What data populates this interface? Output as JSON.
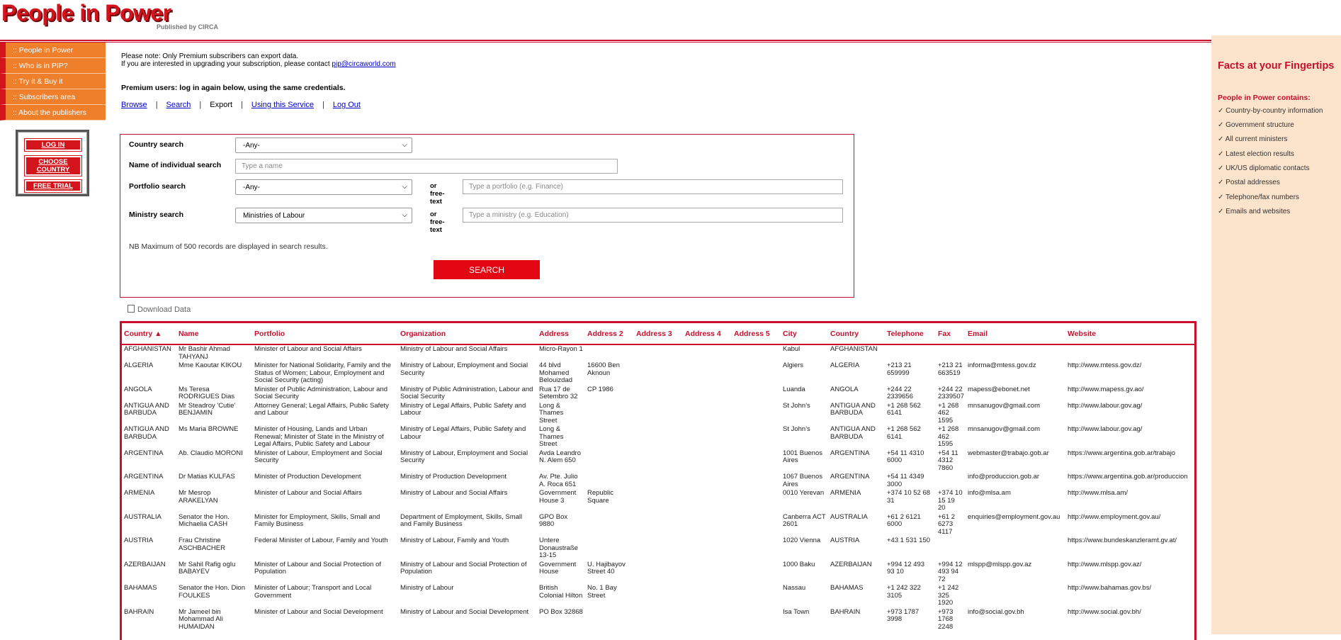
{
  "header": {
    "logo_title": "People in Power",
    "logo_sub": "Published by CIRCA"
  },
  "nav": [
    ":: People in Power",
    ":: Who is in PIP?",
    ":: Try it & Buy it",
    ":: Subscribers area",
    ":: About the publishers"
  ],
  "login_box": {
    "login": "LOG IN",
    "choose_country": "CHOOSE COUNTRY",
    "free_trial": "FREE TRIAL"
  },
  "notes": {
    "line1": "Please note: Only Premium subscribers can export data.",
    "line2": "If you are interested in upgrading your subscription, please contact ",
    "email": "pip@circaworld.com",
    "premium": "Premium users: log in again below, using the same credentials."
  },
  "tabs": {
    "browse": "Browse",
    "search": "Search",
    "export": "Export",
    "using": "Using this Service",
    "logout": "Log Out"
  },
  "form": {
    "country_label": "Country search",
    "country_value": "-Any-",
    "name_label": "Name of individual search",
    "name_placeholder": "Type a name",
    "portfolio_label": "Portfolio search",
    "portfolio_value": "-Any-",
    "portfolio_placeholder": "Type a portfolio (e.g. Finance)",
    "ministry_label": "Ministry search",
    "ministry_value": "Ministries of Labour",
    "ministry_placeholder": "Type a ministry (e.g. Education)",
    "or_text": "or free-text",
    "nb_note": "NB Maximum of 500 records are displayed in search results.",
    "search_button": "SEARCH"
  },
  "download": "Download Data",
  "table": {
    "headers": [
      "Country ▲",
      "Name",
      "Portfolio",
      "Organization",
      "Address",
      "Address 2",
      "Address 3",
      "Address 4",
      "Address 5",
      "City",
      "Country",
      "Telephone",
      "Fax",
      "Email",
      "Website"
    ],
    "rows": [
      [
        "AFGHANISTAN",
        "Mr Bashir Ahmad TAHYANJ",
        "Minister of Labour and Social Affairs",
        "Ministry of Labour and Social Affairs",
        "Micro-Rayon 1",
        "",
        "",
        "",
        "",
        "Kabul",
        "AFGHANISTAN",
        "",
        "",
        "",
        ""
      ],
      [
        "ALGERIA",
        "Mme Kaoutar KIKOU",
        "Minister for National Solidarity, Family and the Status of Women; Labour, Employment and Social Security (acting)",
        "Ministry of Labour, Employment and Social Security",
        "44 blvd Mohamed Belouizdad",
        "16600 Ben Aknoun",
        "",
        "",
        "",
        "Algiers",
        "ALGERIA",
        "+213 21 659999",
        "+213 21 663519",
        "informa@mtess.gov.dz",
        "http://www.mtess.gov.dz/"
      ],
      [
        "ANGOLA",
        "Ms Teresa RODRIGUES Dias",
        "Minister of Public Administration, Labour and Social Security",
        "Ministry of Public Administration, Labour and Social Security",
        "Rua 17 de Setembro 32",
        "CP 1986",
        "",
        "",
        "",
        "Luanda",
        "ANGOLA",
        "+244 22 2339656",
        "+244 22 2339507",
        "mapess@ebonet.net",
        "http://www.mapess.gv.ao/"
      ],
      [
        "ANTIGUA AND BARBUDA",
        "Mr Steadroy 'Cutie' BENJAMIN",
        "Attorney General; Legal Affairs, Public Safety and Labour",
        "Ministry of Legal Affairs, Public Safety and Labour",
        "Long & Thames Street",
        "",
        "",
        "",
        "",
        "St John's",
        "ANTIGUA AND BARBUDA",
        "+1 268 562 6141",
        "+1 268 462 1595",
        "mnsanugov@gmail.com",
        "http://www.labour.gov.ag/"
      ],
      [
        "ANTIGUA AND BARBUDA",
        "Ms Maria BROWNE",
        "Minister of Housing, Lands and Urban Renewal; Minister of State in the Ministry of Legal Affairs, Public Safety and Labour",
        "Ministry of Legal Affairs, Public Safety and Labour",
        "Long & Thames Street",
        "",
        "",
        "",
        "",
        "St John's",
        "ANTIGUA AND BARBUDA",
        "+1 268 562 6141",
        "+1 268 462 1595",
        "mnsanugov@gmail.com",
        "http://www.labour.gov.ag/"
      ],
      [
        "ARGENTINA",
        "Ab. Claudio MORONI",
        "Minister of Labour, Employment and Social Security",
        "Ministry of Labour, Employment and Social Security",
        "Avda Leandro N. Alem 650",
        "",
        "",
        "",
        "",
        "1001 Buenos Aires",
        "ARGENTINA",
        "+54 11 4310 6000",
        "+54 11 4312 7860",
        "webmaster@trabajo.gob.ar",
        "https://www.argentina.gob.ar/trabajo"
      ],
      [
        "ARGENTINA",
        "Dr Matias KULFAS",
        "Minister of Production Development",
        "Ministry of Production Development",
        "Av. Pte. Julio A. Roca 651",
        "",
        "",
        "",
        "",
        "1067 Buenos Aires",
        "ARGENTINA",
        "+54 11 4349 3000",
        "",
        "info@produccion.gob.ar",
        "https://www.argentina.gob.ar/produccion"
      ],
      [
        "ARMENIA",
        "Mr Mesrop ARAKELYAN",
        "Minister of Labour and Social Affairs",
        "Ministry of Labour and Social Affairs",
        "Government House 3",
        "Republic Square",
        "",
        "",
        "",
        "0010 Yerevan",
        "ARMENIA",
        "+374 10 52 68 31",
        "+374 10 15 19 20",
        "info@mlsa.am",
        "http://www.mlsa.am/"
      ],
      [
        "AUSTRALIA",
        "Senator the Hon. Michaelia CASH",
        "Minister for Employment, Skills, Small and Family Business",
        "Department of Employment, Skills, Small and Family Business",
        "GPO Box 9880",
        "",
        "",
        "",
        "",
        "Canberra ACT 2601",
        "AUSTRALIA",
        "+61 2 6121 6000",
        "+61 2 6273 4117",
        "enquiries@employment.gov.au",
        "http://www.employment.gov.au/"
      ],
      [
        "AUSTRIA",
        "Frau Christine ASCHBACHER",
        "Federal Minister of Labour, Family and Youth",
        "Ministry of Labour, Family and Youth",
        "Untere Donaustraße 13-15",
        "",
        "",
        "",
        "",
        "1020 Vienna",
        "AUSTRIA",
        "+43 1 531 150",
        "",
        "",
        "https://www.bundeskanzleramt.gv.at/"
      ],
      [
        "AZERBAIJAN",
        "Mr Sahil Rafig oglu BABAYEV",
        "Minister of Labour and Social Protection of Population",
        "Ministry of Labour and Social Protection of Population",
        "Government House",
        "U. Hajibayov Street 40",
        "",
        "",
        "",
        "1000 Baku",
        "AZERBAIJAN",
        "+994 12 493 93 10",
        "+994 12 493 94 72",
        "mlspp@mlspp.gov.az",
        "http://www.mlspp.gov.az/"
      ],
      [
        "BAHAMAS",
        "Senator the Hon. Dion FOULKES",
        "Minister of Labour; Transport and Local Government",
        "Ministry of Labour",
        "British Colonial Hilton",
        "No. 1 Bay Street",
        "",
        "",
        "",
        "Nassau",
        "BAHAMAS",
        "+1 242 322 3105",
        "+1 242 325 1920",
        "",
        "http://www.bahamas.gov.bs/"
      ],
      [
        "BAHRAIN",
        "Mr Jameel bin Mohammad Ali HUMAIDAN",
        "Minister of Labour and Social Development",
        "Ministry of Labour and Social Development",
        "PO Box 32868",
        "",
        "",
        "",
        "",
        "Isa Town",
        "BAHRAIN",
        "+973 1787 3998",
        "+973 1768 2248",
        "info@social.gov.bh",
        "http://www.social.gov.bh/"
      ]
    ]
  },
  "facts": {
    "title": "Facts at your Fingertips",
    "subtitle": "People in Power contains:",
    "items": [
      "✓ Country-by-country information",
      "✓ Government structure",
      "✓ All current ministers",
      "✓ Latest election results",
      "✓ UK/US diplomatic contacts",
      "✓ Postal addresses",
      "✓ Telephone/fax numbers",
      "✓ Emails and websites"
    ]
  }
}
